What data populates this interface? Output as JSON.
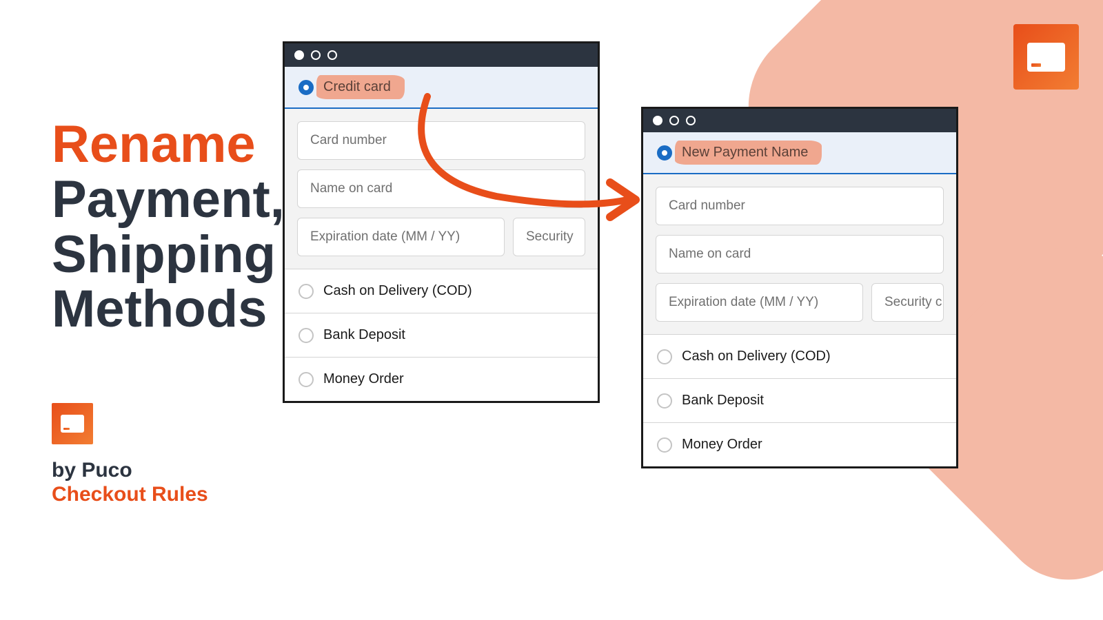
{
  "headline": {
    "rename": "Rename",
    "payment": "Payment,",
    "shipping": "Shipping",
    "methods": "Methods"
  },
  "branding": {
    "by": "by Puco",
    "product": "Checkout Rules"
  },
  "window1": {
    "selected": "Credit card",
    "inputs": {
      "card_number": "Card number",
      "name_on_card": "Name on card",
      "expiration": "Expiration date (MM / YY)",
      "security": "Security"
    },
    "methods": [
      "Cash on Delivery (COD)",
      "Bank Deposit",
      "Money Order"
    ]
  },
  "window2": {
    "selected": "New Payment Name",
    "inputs": {
      "card_number": "Card number",
      "name_on_card": "Name on card",
      "expiration": "Expiration date (MM / YY)",
      "security": "Security c"
    },
    "methods": [
      "Cash on Delivery (COD)",
      "Bank Deposit",
      "Money Order"
    ]
  }
}
